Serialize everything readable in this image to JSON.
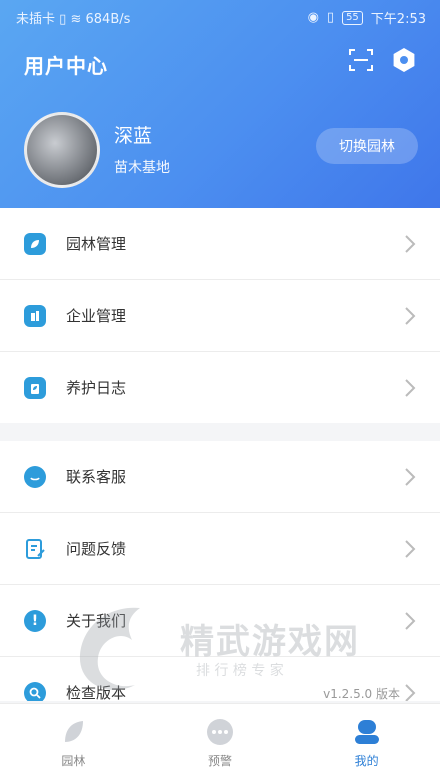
{
  "status": {
    "carrier": "未插卡",
    "speed": "684B/s",
    "battery": "55",
    "time": "下午2:53"
  },
  "header": {
    "title": "用户中心",
    "switch_label": "切换园林"
  },
  "profile": {
    "name": "深蓝",
    "subtitle": "苗木基地"
  },
  "menu1": [
    {
      "label": "园林管理",
      "icon": "leaf-icon"
    },
    {
      "label": "企业管理",
      "icon": "building-icon"
    },
    {
      "label": "养护日志",
      "icon": "clipboard-icon"
    }
  ],
  "menu2": [
    {
      "label": "联系客服",
      "icon": "chat-icon"
    },
    {
      "label": "问题反馈",
      "icon": "edit-icon"
    },
    {
      "label": "关于我们",
      "icon": "info-icon"
    },
    {
      "label": "检查版本",
      "icon": "search-icon",
      "value": "v1.2.5.0 版本"
    }
  ],
  "tabs": [
    {
      "label": "园林",
      "icon": "leaf-tab-icon",
      "active": false
    },
    {
      "label": "预警",
      "icon": "chat-dots-icon",
      "active": false
    },
    {
      "label": "我的",
      "icon": "user-icon",
      "active": true
    }
  ],
  "watermark": {
    "title": "精武游戏网",
    "subtitle": "排 行 榜 专 家"
  },
  "colors": {
    "accent": "#2d9cdb",
    "header_start": "#5aa7f2",
    "header_end": "#3f76ea"
  }
}
